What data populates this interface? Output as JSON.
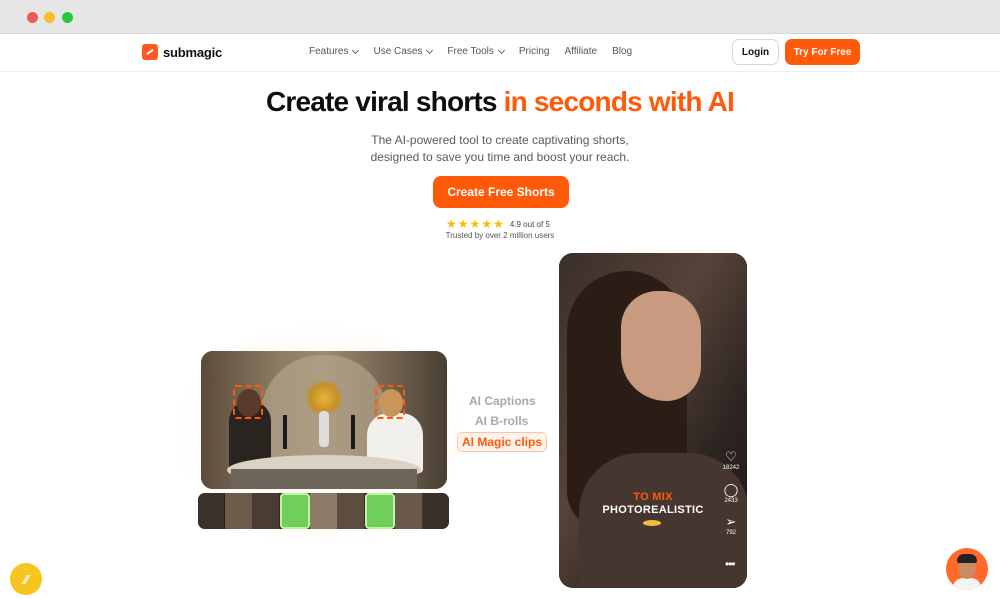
{
  "brand": {
    "name": "submagic",
    "accent": "#ff5a0a"
  },
  "nav": {
    "items": [
      {
        "label": "Features",
        "dropdown": true
      },
      {
        "label": "Use Cases",
        "dropdown": true
      },
      {
        "label": "Free Tools",
        "dropdown": true
      },
      {
        "label": "Pricing",
        "dropdown": false
      },
      {
        "label": "Affiliate",
        "dropdown": false
      },
      {
        "label": "Blog",
        "dropdown": false
      }
    ],
    "login_label": "Login",
    "try_label": "Try For Free"
  },
  "hero": {
    "headline_main": "Create viral shorts ",
    "headline_accent": "in seconds with AI",
    "subtitle_line1": "The AI-powered tool to create captivating shorts,",
    "subtitle_line2": "designed to save you time and boost your reach.",
    "cta_label": "Create Free Shorts",
    "rating_stars": 5,
    "rating_text": "4.9 out of 5",
    "trusted_text": "Trusted by over 2 million users"
  },
  "features": [
    {
      "label": "AI Captions",
      "active": false
    },
    {
      "label": "AI B-rolls",
      "active": false
    },
    {
      "label": "AI Magic clips",
      "active": true
    }
  ],
  "phone": {
    "caption_line1": "TO MIX",
    "caption_line2": "PHOTOREALISTIC",
    "likes": "18242",
    "comments": "2433",
    "shares": "792",
    "like_icon": "heart-icon",
    "comment_icon": "comment-icon",
    "share_icon": "send-icon",
    "more_icon": "more-icon"
  }
}
